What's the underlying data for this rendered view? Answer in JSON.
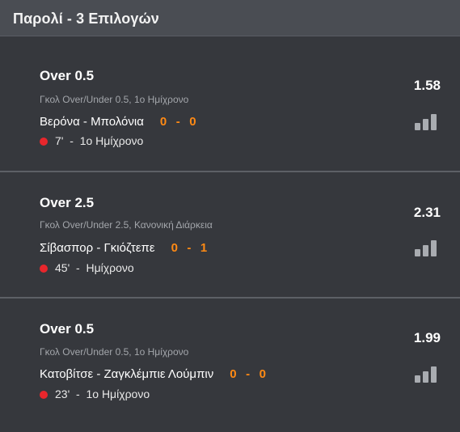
{
  "header": {
    "title": "Παρολί - 3 Επιλογών"
  },
  "bets": [
    {
      "selection": "Over 0.5",
      "market": "Γκολ Over/Under 0.5, 1ο Ημίχρονο",
      "match": "Βερόνα - Μπολόνια",
      "score_home": "0",
      "score_away": "0",
      "live_time": "7'",
      "period": "1ο Ημίχρονο",
      "odds": "1.58",
      "stats_icon": "bar-chart-icon"
    },
    {
      "selection": "Over 2.5",
      "market": "Γκολ Over/Under 2.5, Κανονική Διάρκεια",
      "match": "Σίβασπορ - Γκιόζτεπε",
      "score_home": "0",
      "score_away": "1",
      "live_time": "45'",
      "period": "Ημίχρονο",
      "odds": "2.31",
      "stats_icon": "bar-chart-icon"
    },
    {
      "selection": "Over 0.5",
      "market": "Γκολ Over/Under 0.5, 1ο Ημίχρονο",
      "match": "Κατοβίτσε - Ζαγκλέμπιε Λούμπιν",
      "score_home": "0",
      "score_away": "0",
      "live_time": "23'",
      "period": "1ο Ημίχρονο",
      "odds": "1.99",
      "stats_icon": "bar-chart-icon"
    }
  ],
  "colors": {
    "background": "#36383d",
    "header": "#4a4d53",
    "score": "#ff8a14",
    "live_dot": "#e8262c"
  }
}
